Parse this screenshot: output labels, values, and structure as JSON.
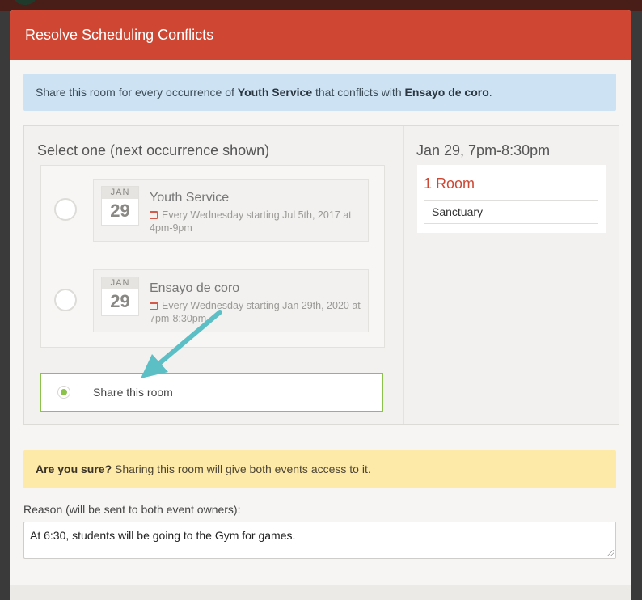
{
  "modal": {
    "title": "Resolve Scheduling Conflicts"
  },
  "info": {
    "prefix": "Share this room for every occurrence of ",
    "event_a": "Youth Service",
    "middle": " that conflicts with ",
    "event_b": "Ensayo de coro",
    "suffix": "."
  },
  "selection": {
    "title": "Select one (next occurrence shown)",
    "options": [
      {
        "month": "JAN",
        "day": "29",
        "name": "Youth Service",
        "recurrence": "Every Wednesday starting Jul 5th, 2017 at 4pm-9pm"
      },
      {
        "month": "JAN",
        "day": "29",
        "name": "Ensayo de coro",
        "recurrence": "Every Wednesday starting Jan 29th, 2020 at 7pm-8:30pm"
      }
    ],
    "share_label": "Share this room"
  },
  "occurrence": {
    "date": "Jan 29, 7pm-8:30pm",
    "room_count": "1 Room",
    "rooms": [
      "Sanctuary"
    ]
  },
  "warning": {
    "bold": "Are you sure?",
    "text": " Sharing this room will give both events access to it."
  },
  "reason": {
    "label": "Reason (will be sent to both event owners):",
    "value": "At 6:30, students will be going to the Gym for games."
  },
  "colors": {
    "header": "#cf4733",
    "info_bg": "#cde3f4",
    "warning_bg": "#fde9a8",
    "selected": "#8bc34a",
    "arrow": "#5bbfc5"
  }
}
